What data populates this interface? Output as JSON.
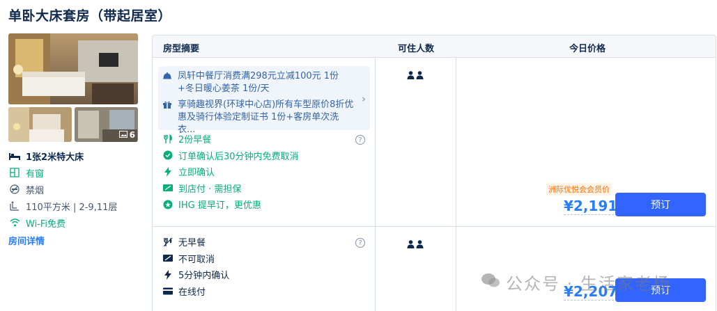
{
  "room": {
    "title": "单卧大床套房（带起居室）",
    "photo_count": "6",
    "bed": "1张2米特大床",
    "window": "有窗",
    "smoking": "禁烟",
    "area": "110平方米 | 2-9,11层",
    "wifi": "Wi-Fi免费",
    "details_link": "房间详情"
  },
  "table": {
    "headers": [
      "房型摘要",
      "可住人数",
      "今日价格"
    ]
  },
  "offers": [
    {
      "promos": [
        {
          "icon": "dining-bell-icon",
          "text": "凤轩中餐厅消费满298元立减100元 1份+冬日暖心姜茶 1份/天"
        },
        {
          "icon": "gift-icon",
          "text": "享骑趣视界(环球中心店)所有车型原价8折优惠及骑行体验定制证书 1份+客房单次洗衣..."
        }
      ],
      "policies": [
        {
          "icon": "breakfast-icon",
          "text": "2份早餐",
          "style": "green"
        },
        {
          "icon": "check-circle-icon",
          "text": "订单确认后30分钟内免费取消",
          "style": "green"
        },
        {
          "icon": "lightning-icon",
          "text": "立即确认",
          "style": "green"
        },
        {
          "icon": "pay-at-hotel-icon",
          "text": "到店付 · 需担保",
          "style": "green"
        },
        {
          "icon": "star-circle-icon",
          "text": "IHG 提早订，更优惠",
          "style": "green"
        }
      ],
      "member_badge": "洲际优悦会会员价",
      "price": "¥2,191",
      "book_label": "预订"
    },
    {
      "promos": [],
      "policies": [
        {
          "icon": "no-breakfast-icon",
          "text": "无早餐",
          "style": "dark"
        },
        {
          "icon": "no-cancel-icon",
          "text": "不可取消",
          "style": "dark"
        },
        {
          "icon": "lightning-icon",
          "text": "5分钟内确认",
          "style": "dark"
        },
        {
          "icon": "card-icon",
          "text": "在线付",
          "style": "dark"
        }
      ],
      "member_badge": "",
      "price": "¥2,207",
      "book_label": "预订"
    }
  ],
  "watermark": "公众号 · 生活家老杨",
  "colors": {
    "accent": "#287dfa",
    "button": "#3264ff",
    "green": "#06ae7a",
    "promo_text": "#3264a8",
    "badge": "#ff6f00"
  }
}
